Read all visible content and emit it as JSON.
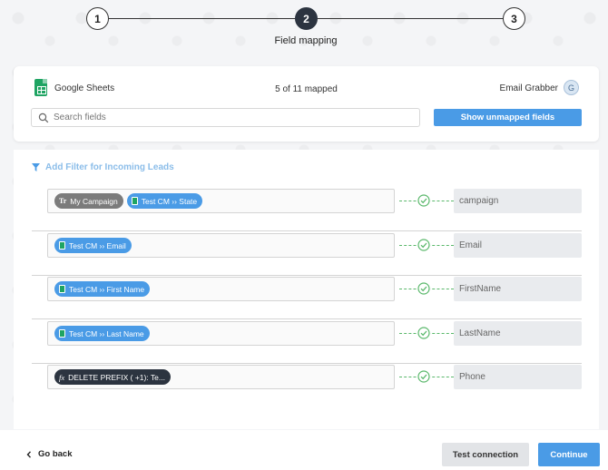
{
  "stepper": {
    "steps": [
      {
        "number": "1"
      },
      {
        "number": "2"
      },
      {
        "number": "3"
      }
    ],
    "active_label": "Field mapping"
  },
  "header": {
    "source_name": "Google Sheets",
    "mapped_count": "5 of 11 mapped",
    "dest_name": "Email Grabber",
    "dest_avatar": "G",
    "search_placeholder": "Search fields",
    "unmapped_button": "Show unmapped fields"
  },
  "filter": {
    "label": "Add Filter for Incoming Leads"
  },
  "mappings": [
    {
      "chips": [
        {
          "icon": "text-icon",
          "label": "My Campaign"
        },
        {
          "icon": "sheet-icon",
          "label": "Test CM ›› State"
        }
      ],
      "target": "campaign"
    },
    {
      "chips": [
        {
          "icon": "sheet-icon",
          "label": "Test CM ›› Email"
        }
      ],
      "target": "Email"
    },
    {
      "chips": [
        {
          "icon": "sheet-icon",
          "label": "Test CM ›› First Name"
        }
      ],
      "target": "FirstName"
    },
    {
      "chips": [
        {
          "icon": "sheet-icon",
          "label": "Test CM ›› Last Name"
        }
      ],
      "target": "LastName"
    },
    {
      "chips": [
        {
          "icon": "function-icon",
          "label": "DELETE PREFIX ( +1): Te..."
        }
      ],
      "target": "Phone"
    }
  ],
  "footer": {
    "go_back": "Go back",
    "test_connection": "Test connection",
    "continue": "Continue"
  },
  "colors": {
    "accent": "#4a9be6",
    "success": "#5ab86b",
    "dark": "#2c3440"
  }
}
